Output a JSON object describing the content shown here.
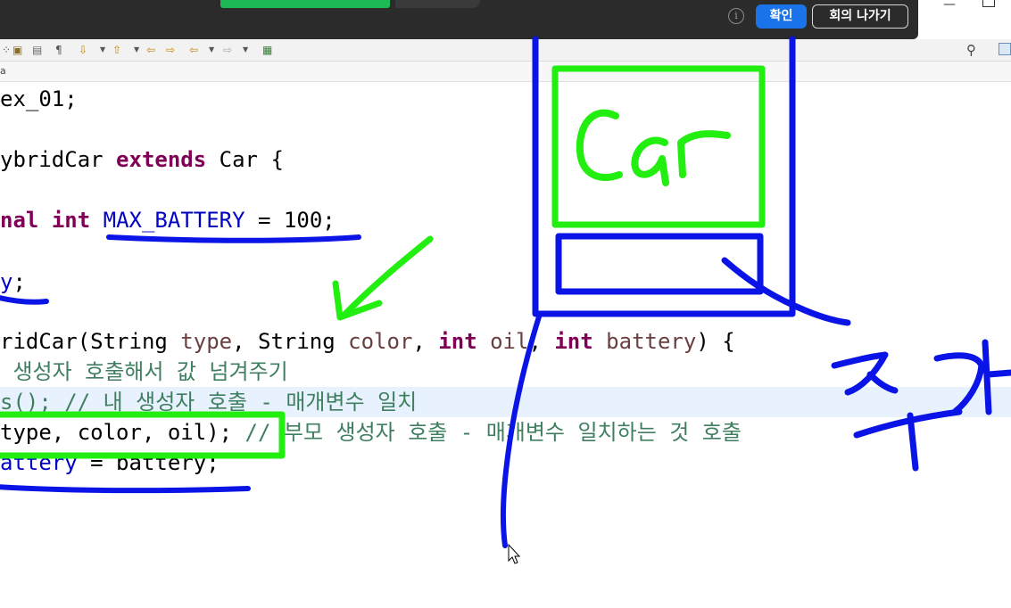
{
  "meeting_bar": {
    "notice_text": "",
    "info_icon": "info-icon",
    "confirm_label": "확인",
    "leave_label": "회의 나가기"
  },
  "editor_tab": {
    "label": "a"
  },
  "code": {
    "line1": {
      "text": "ex_01;"
    },
    "line2": {
      "plain1": "ybridCar ",
      "kw": "extends",
      "plain2": " Car {"
    },
    "line3": {
      "kw1": "nal",
      "kw2": "int",
      "field": "MAX_BATTERY",
      "plain": " = 100;"
    },
    "line4": {
      "field": "y",
      "plain": ";"
    },
    "line5": {
      "plain1": "ridCar(String ",
      "v1": "type",
      "plain2": ", String ",
      "v2": "color",
      "sep1": ", ",
      "kw1": "int",
      "v3": " oil",
      "sep2": ", ",
      "kw2": "int",
      "v4": " battery",
      "plain3": ") {"
    },
    "line6": {
      "comment": " 생성자 호출해서 값 넘겨주기"
    },
    "line7": {
      "plain": "s();",
      "comment": " // 내 생성자 호출 - 매개변수 일치"
    },
    "line8": {
      "plain": "type, color, oil);",
      "comment": " // 부모 생성자 호출 - 매개변수 일치하는 것 호출"
    },
    "line9": {
      "field": "attery",
      "plain": " = battery;"
    }
  },
  "annotations": {
    "handwritten_word_box": "Car",
    "handwritten_word_right": "추가",
    "colors": {
      "blue_pen": "#0a14e6",
      "green_pen": "#22ee10"
    }
  }
}
